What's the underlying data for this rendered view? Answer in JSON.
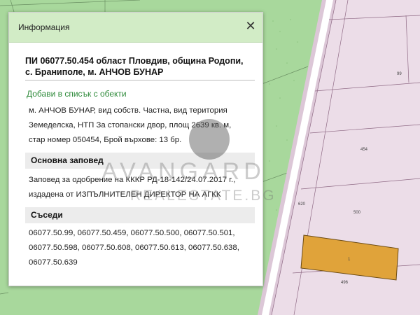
{
  "popup": {
    "title": "Информация",
    "close_glyph": "✕",
    "parcel_title_line1": "ПИ 06077.50.454 област Пловдив, община Родопи,",
    "parcel_title_line2": "с. Браниполе, м. АНЧОВ БУНАР",
    "add_link": "Добави в списък с обекти",
    "details_lines": [
      "м. АНЧОВ БУНАР, вид собств. Частна, вид територия",
      "Земеделска, НТП За стопански двор, площ 2639 кв. м,",
      "стар номер 050454, Брой върхове: 13 бр."
    ],
    "order_heading": "Основна заповед",
    "order_lines": [
      "Заповед за одобрение на КККР РД-18-142/24.07.2017 г.,",
      "издадена от ИЗПЪЛНИТЕЛЕН ДИРЕКТОР НА АГКК"
    ],
    "neighbors_heading": "Съседи",
    "neighbors_lines": [
      "06077.50.99, 06077.50.459, 06077.50.500, 06077.50.501,",
      "06077.50.598, 06077.50.608, 06077.50.613, 06077.50.638,",
      "06077.50.639"
    ]
  },
  "map": {
    "labels": [
      "99",
      "454",
      "620",
      "500",
      "1",
      "496"
    ],
    "colors": {
      "agri_green": "#a8d89c",
      "parcel_pink": "#ecdde8",
      "road_white": "#ffffff",
      "highlight": "#e0a33a"
    }
  },
  "watermark": {
    "line1": "AVANGARD",
    "line2": "REALESTATE.BG"
  }
}
